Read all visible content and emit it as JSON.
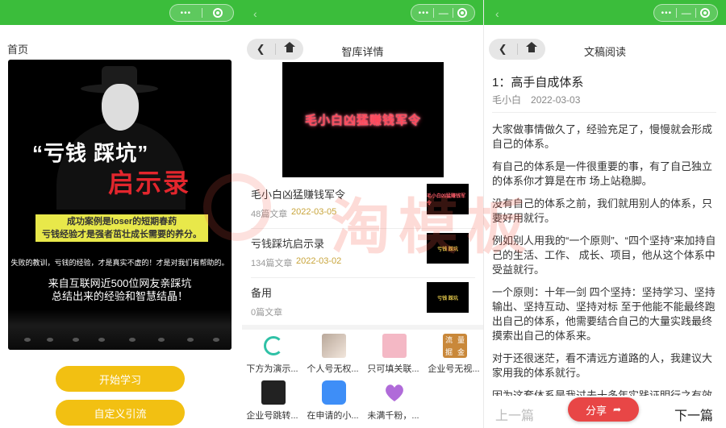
{
  "panel1": {
    "title": "首页",
    "poster": {
      "quote_line1": "“亏钱 踩坑”",
      "quote_line2": "启示录",
      "highlight_line1": "成功案例是loser的短期春药",
      "highlight_line2": "亏钱经验才是强者茁壮成长需要的养分。",
      "small_text": "失败的教训，亏钱的经验，才是真实不虚的！才是对我们有帮助的。",
      "mid_line1": "来自互联网近500位网友亲踩坑",
      "mid_line2": "总结出来的经验和智慧结晶！"
    },
    "buttons": {
      "start": "开始学习",
      "custom": "自定义引流"
    }
  },
  "panel2": {
    "nav_title": "智库详情",
    "banner_text": "毛小白凶猛赚钱军令",
    "items": [
      {
        "name": "毛小白凶猛赚钱军令",
        "count": "48篇文章",
        "date": "2022-03-05",
        "thumb_text": "毛小白凶猛赚钱军令"
      },
      {
        "name": "亏钱踩坑启示录",
        "count": "134篇文章",
        "date": "2022-03-02",
        "thumb_text": "亏钱 踩坑"
      },
      {
        "name": "备用",
        "count": "0篇文章",
        "date": "",
        "thumb_text": "亏钱 踩坑"
      }
    ],
    "grid": [
      {
        "label": "下方为演示...",
        "icon": "loading-ring-icon"
      },
      {
        "label": "个人号无权...",
        "icon": "cat-photo-icon"
      },
      {
        "label": "只可填关联...",
        "icon": "envelope-icon"
      },
      {
        "label": "企业号无视...",
        "icon": "fortune-icon",
        "glyphs": [
          "流",
          "量",
          "掘",
          "金"
        ]
      },
      {
        "label": "企业号跳转...",
        "icon": "dark-poster-icon"
      },
      {
        "label": "在申请的小...",
        "icon": "chat-bubble-icon"
      },
      {
        "label": "未满千粉，...",
        "icon": "heart-icon"
      }
    ]
  },
  "panel3": {
    "nav_title": "文稿阅读",
    "article_title": "1：高手自成体系",
    "author": "毛小白",
    "date": "2022-03-03",
    "paragraphs": [
      "大家做事情做久了，经验充足了，慢慢就会形成自己的体系。",
      "有自己的体系是一件很重要的事，有了自己独立的体系你才算是在市 场上站稳脚。",
      "没有自己的体系之前，我们就用别人的体系，只要好用就行。",
      "例如别人用我的“一个原则”、“四个坚持”来加持自己的生活、工作、 成长、项目，他从这个体系中受益就行。",
      "一个原则：十年一剑 四个坚持：坚持学习、坚持输出、坚持互动、坚持对标 至于他能不能最终跑出自己的体系，他需要结合自己的大量实践最终摸索出自己的体系来。",
      "对于还很迷茫，看不清远方道路的人，我建议大家用我的体系就行。",
      "因为这套体系是我过去十多年实践证明行之有效"
    ],
    "prev": "上一篇",
    "next": "下一篇",
    "share": "分享"
  },
  "watermark": "淘模板",
  "colors": {
    "topbar": "#3bbd3b",
    "button_yellow": "#f2c012",
    "share_red": "#e84646",
    "date_gold": "#c8a43a"
  }
}
